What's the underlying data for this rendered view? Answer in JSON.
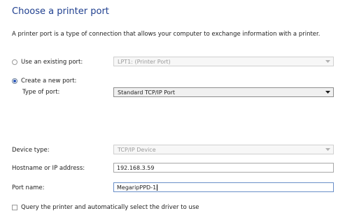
{
  "page": {
    "title": "Choose a printer port",
    "description": "A printer port is a type of connection that allows your computer to exchange information with a printer."
  },
  "existing_port": {
    "label": "Use an existing port:",
    "value": "LPT1: (Printer Port)",
    "selected": false
  },
  "new_port": {
    "label": "Create a new port:",
    "selected": true,
    "type_label": "Type of port:",
    "type_value": "Standard TCP/IP Port"
  },
  "device_type": {
    "label": "Device type:",
    "value": "TCP/IP Device"
  },
  "hostname": {
    "label": "Hostname or IP address:",
    "value": "192.168.3.59"
  },
  "port_name": {
    "label": "Port name:",
    "value": "MegaripPPD-1"
  },
  "query_printer": {
    "label": "Query the printer and automatically select the driver to use",
    "checked": false
  },
  "icons": {
    "dropdown_arrow": "chevron-down-icon"
  }
}
